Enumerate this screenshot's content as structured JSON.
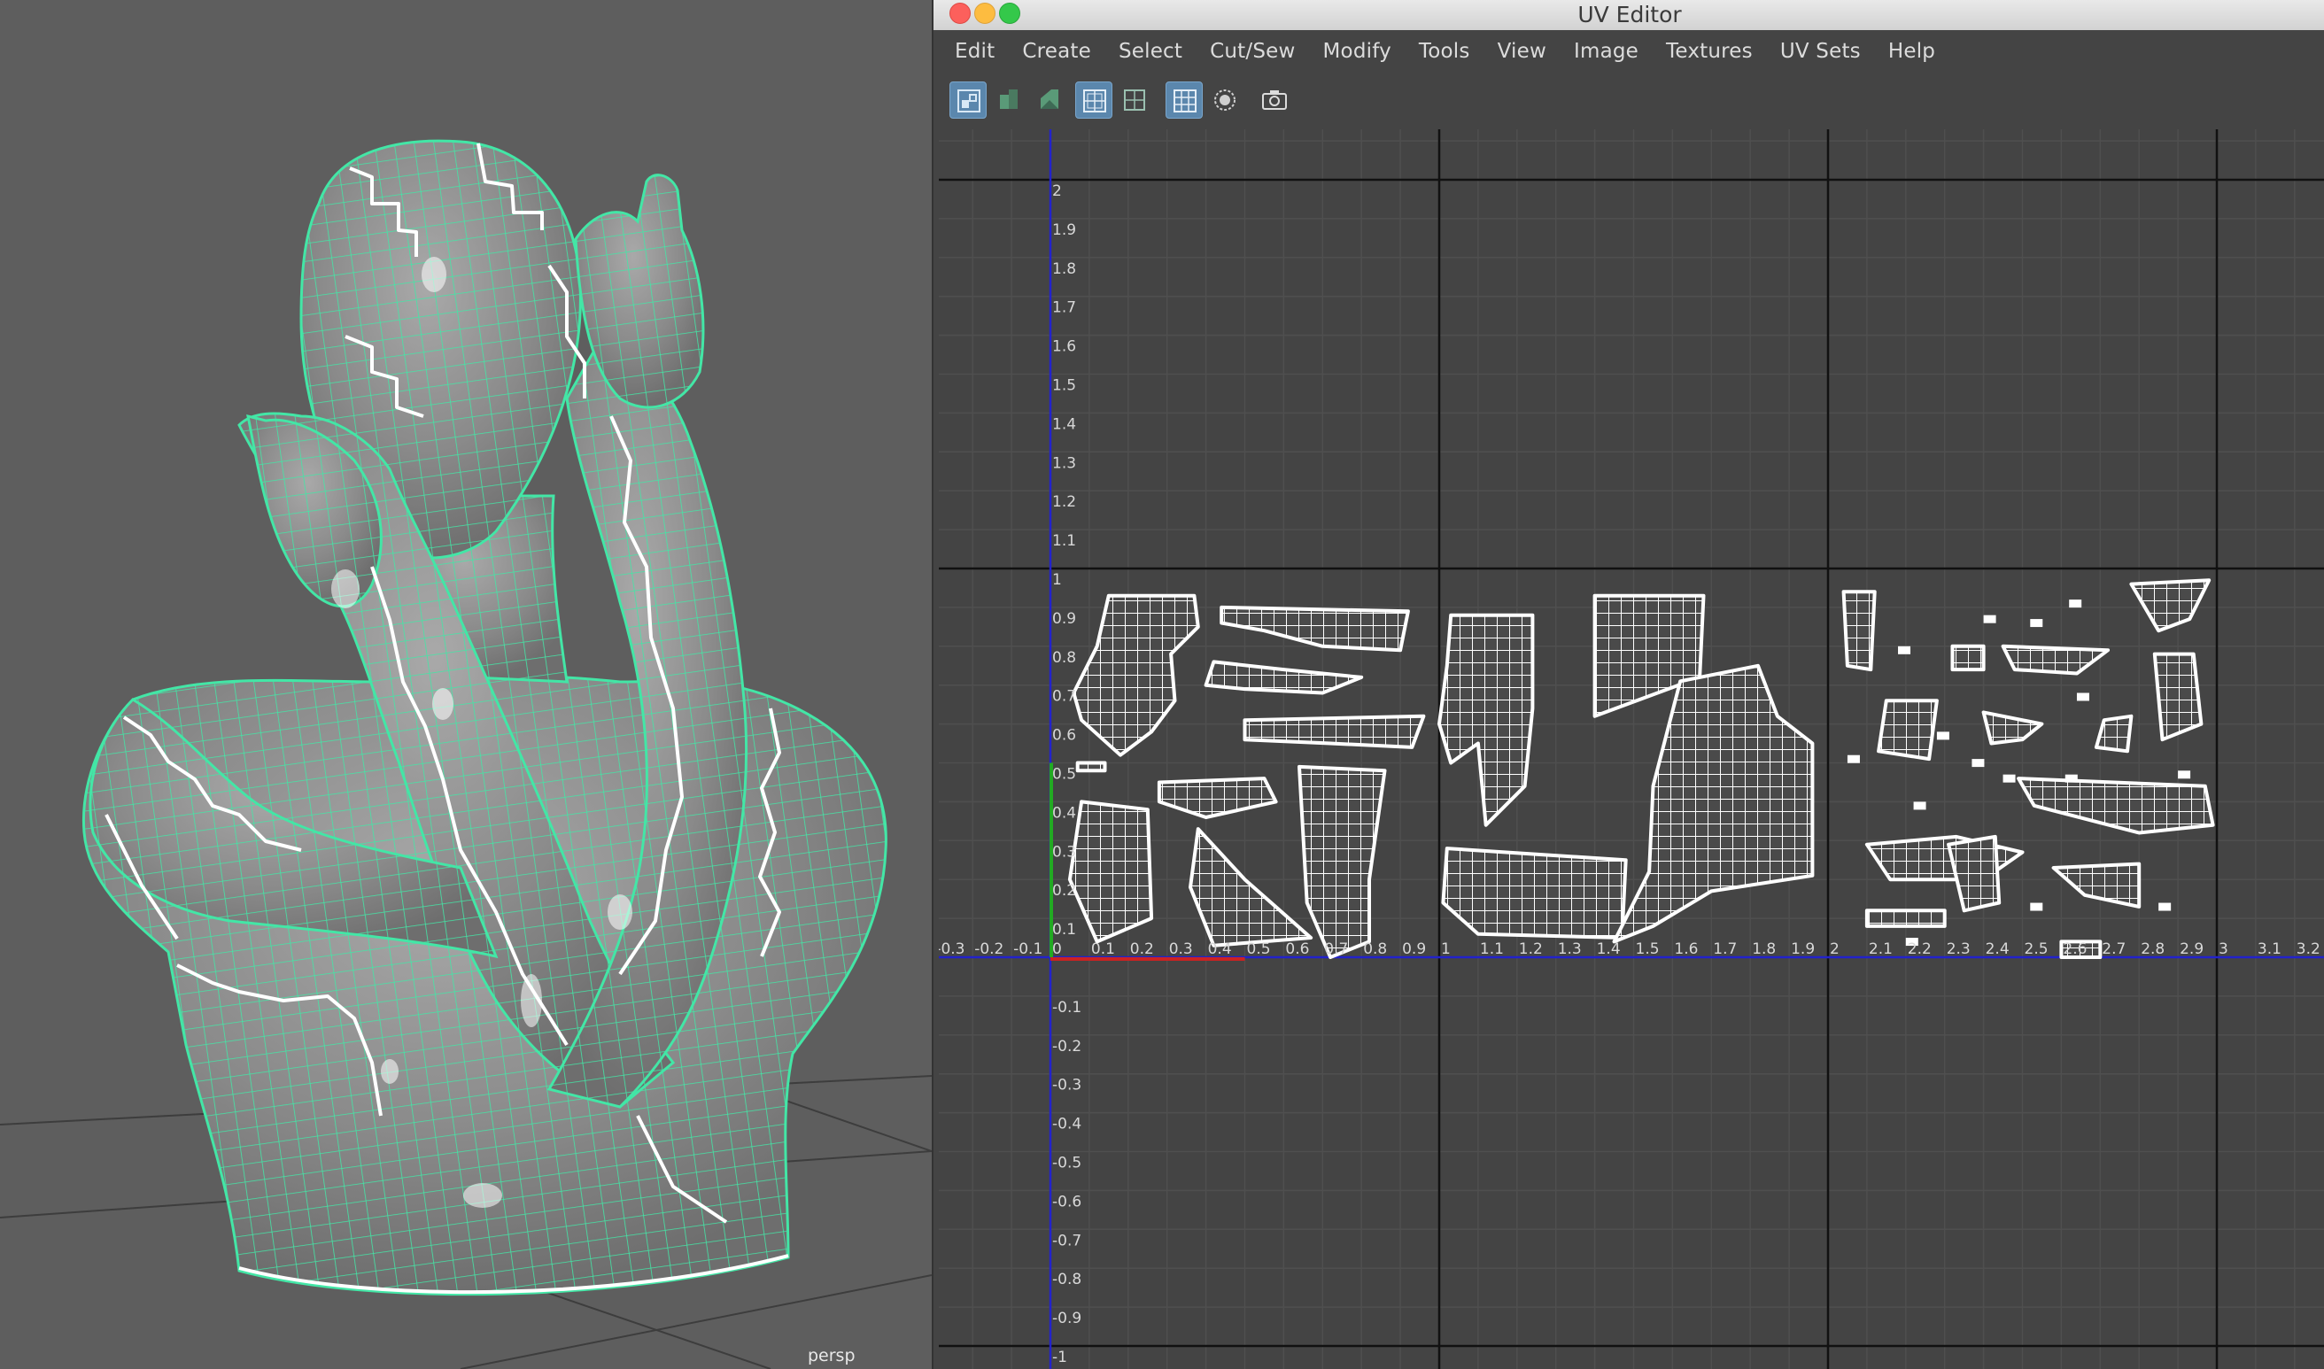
{
  "viewport": {
    "camera_label": "persp"
  },
  "window": {
    "title": "UV Editor",
    "traffic_lights": {
      "close_color": "#fc605c",
      "minimize_color": "#fdbc40",
      "zoom_color": "#34c84a"
    }
  },
  "menu": [
    "Edit",
    "Create",
    "Select",
    "Cut/Sew",
    "Modify",
    "Tools",
    "View",
    "Image",
    "Textures",
    "UV Sets",
    "Help"
  ],
  "toolbar": {
    "icons": [
      "uv-shell-icon",
      "uv-unfold-icon",
      "uv-distort-icon",
      "grid-display-icon",
      "texture-borders-icon",
      "checker-icon",
      "isolate-icon",
      "snapshot-icon"
    ],
    "active": [
      "uv-shell-icon",
      "grid-display-icon",
      "checker-icon"
    ]
  },
  "uv_grid": {
    "u_ticks": [
      "-0.3",
      "-0.2",
      "-0.1",
      "0",
      "0.1",
      "0.2",
      "0.3",
      "0.4",
      "0.5",
      "0.6",
      "0.7",
      "0.8",
      "0.9",
      "1",
      "1.1",
      "1.2",
      "1.3",
      "1.4",
      "1.5",
      "1.6",
      "1.7",
      "1.8",
      "1.9",
      "2",
      "2.1",
      "2.2",
      "2.3",
      "2.4",
      "2.5",
      "2.6",
      "2.7",
      "2.8",
      "2.9",
      "3",
      "3.1",
      "3.2"
    ],
    "v_ticks": [
      "2",
      "1.9",
      "1.8",
      "1.7",
      "1.6",
      "1.5",
      "1.4",
      "1.3",
      "1.2",
      "1.1",
      "1",
      "0.9",
      "0.8",
      "0.7",
      "0.6",
      "0.5",
      "0.4",
      "0.3",
      "0.2",
      "0.1",
      "-0.1",
      "-0.2",
      "-0.3",
      "-0.4",
      "-0.5",
      "-0.6",
      "-0.7",
      "-0.8",
      "-0.9",
      "-1"
    ],
    "tiles": [
      "0-1",
      "1-2",
      "2-3"
    ],
    "colors": {
      "u_axis": "#2222cc",
      "v_axis": "#2222cc",
      "origin_u": "#cc2222",
      "origin_v": "#22aa22",
      "shell": "#ffffff",
      "grid_fine": "#4f4f4f",
      "grid_major": "#111111"
    }
  },
  "mesh": {
    "wire_color": "#43e6a6",
    "seam_color": "#ffffff",
    "surface_color": "#8a8a8a"
  }
}
